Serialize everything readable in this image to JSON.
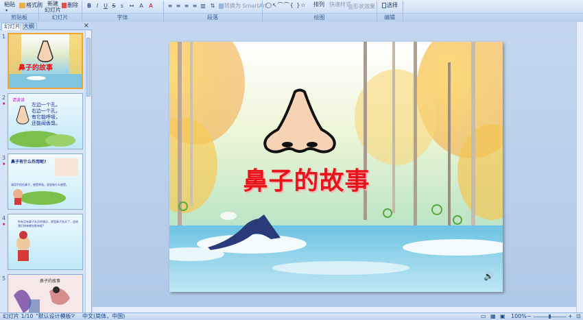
{
  "ribbon": {
    "paste": "粘贴",
    "format_painter": "格式刷",
    "new_slide": "新建\n幻灯片",
    "delete": "删除",
    "convert_smartart": "转换为 SmartArt",
    "arrange": "排列",
    "quick_styles": "快速样式",
    "shape_effects": "形状效果",
    "select": "选择",
    "groups": [
      "剪贴板",
      "幻灯片",
      "字体",
      "段落",
      "绘图",
      "编辑"
    ]
  },
  "left_panel": {
    "tabs": [
      "幻灯片",
      "大纲"
    ],
    "close": "×",
    "slides": [
      {
        "num": "1",
        "title": "鼻子的故事"
      },
      {
        "num": "2",
        "label": "请读读",
        "lines": [
          "左边一个孔，",
          "右边一个孔，",
          "有它能呼吸，",
          "还能闻香臭。"
        ]
      },
      {
        "num": "3",
        "title": "鼻子有什么作用呢?",
        "text": "请用手捂住鼻子，感受呼吸，说说有什么感受。"
      },
      {
        "num": "4",
        "text": "你有没有鼻子失灵的情况，就是鼻子失灵了，会给我们带来哪些影响呢?"
      },
      {
        "num": "5",
        "title": "鼻子的故事"
      }
    ]
  },
  "slide": {
    "title": "鼻子的故事"
  },
  "status_bar": {
    "slide_info": "幻灯片 1/10",
    "theme": "\"默认设计模板\"",
    "language": "中文(简体，中国)",
    "zoom": "100%"
  },
  "colors": {
    "title_red": "#e8141b",
    "ribbon_bg": "#cfe0f5",
    "selection": "#f1a531"
  }
}
